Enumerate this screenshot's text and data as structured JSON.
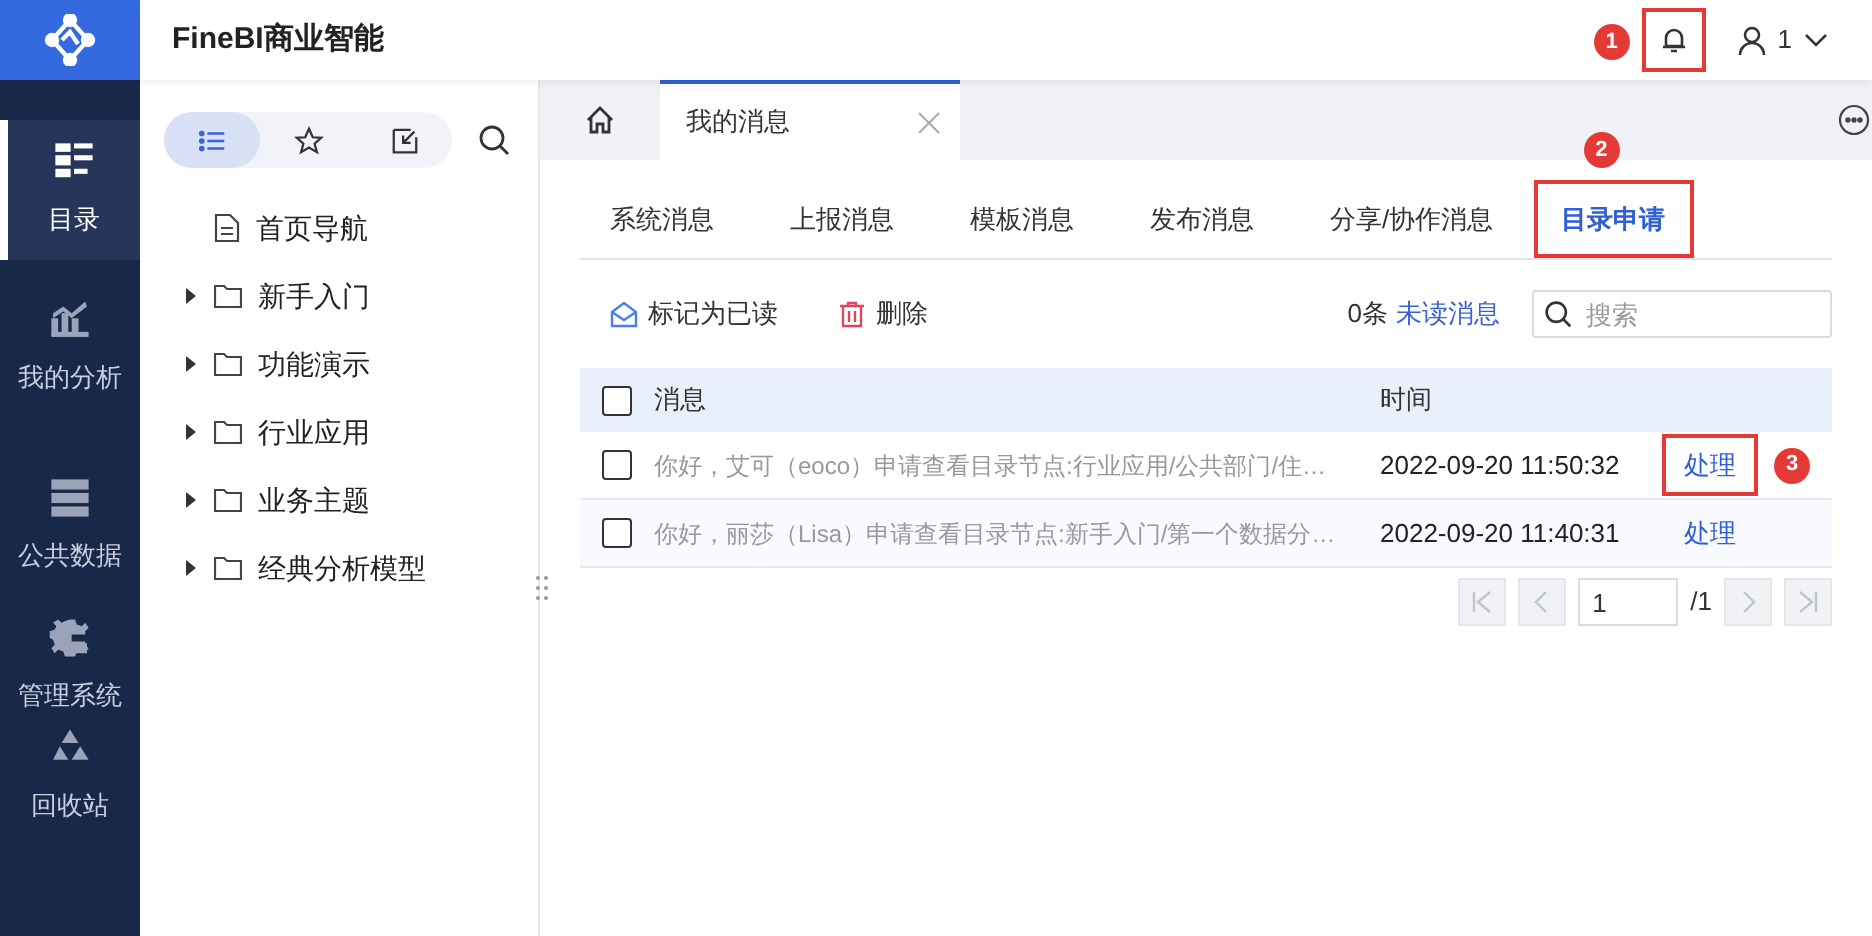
{
  "app": {
    "title": "FineBI商业智能"
  },
  "header": {
    "bell": {
      "highlighted": true,
      "callout": "1"
    },
    "user": "1"
  },
  "nav": [
    {
      "label": "目录",
      "selected": true
    },
    {
      "label": "我的分析",
      "selected": false
    },
    {
      "label": "公共数据",
      "selected": false
    },
    {
      "label": "管理系统",
      "selected": false
    },
    {
      "label": "回收站",
      "selected": false
    }
  ],
  "tree_toolbar": [
    {
      "selected": true
    },
    {
      "selected": false
    },
    {
      "selected": false
    }
  ],
  "tree": [
    {
      "label": "首页导航",
      "kind": "page"
    },
    {
      "label": "新手入门",
      "kind": "folder",
      "expanded": false
    },
    {
      "label": "功能演示",
      "kind": "folder",
      "expanded": false
    },
    {
      "label": "行业应用",
      "kind": "folder",
      "expanded": false
    },
    {
      "label": "业务主题",
      "kind": "folder",
      "expanded": false
    },
    {
      "label": "经典分析模型",
      "kind": "folder",
      "expanded": false
    }
  ],
  "tabs": [
    {
      "label": "我的消息",
      "selected": true
    }
  ],
  "subtabs": [
    {
      "label": "系统消息",
      "selected": false
    },
    {
      "label": "上报消息",
      "selected": false
    },
    {
      "label": "模板消息",
      "selected": false
    },
    {
      "label": "发布消息",
      "selected": false
    },
    {
      "label": "分享/协作消息",
      "selected": false
    },
    {
      "label": "目录申请",
      "selected": true,
      "highlighted": true,
      "callout": "2"
    }
  ],
  "toolbar": {
    "mark_read": "标记为已读",
    "delete": "删除",
    "count": "0条",
    "unread": "未读消息",
    "search_placeholder": "搜索"
  },
  "table": {
    "all_checked": false,
    "columns": [
      "消息",
      "时间"
    ],
    "rows": [
      {
        "checked": false,
        "message": "你好，艾可（eoco）申请查看目录节点:行业应用/公共部门/住…",
        "time": "2022-09-20 11:50:32",
        "action": "处理",
        "highlighted": true,
        "callout": "3"
      },
      {
        "checked": false,
        "message": "你好，丽莎（Lisa）申请查看目录节点:新手入门/第一个数据分…",
        "time": "2022-09-20 11:40:31",
        "action": "处理",
        "highlighted": false
      }
    ]
  },
  "pagination": {
    "page": "1",
    "total": "/1"
  }
}
